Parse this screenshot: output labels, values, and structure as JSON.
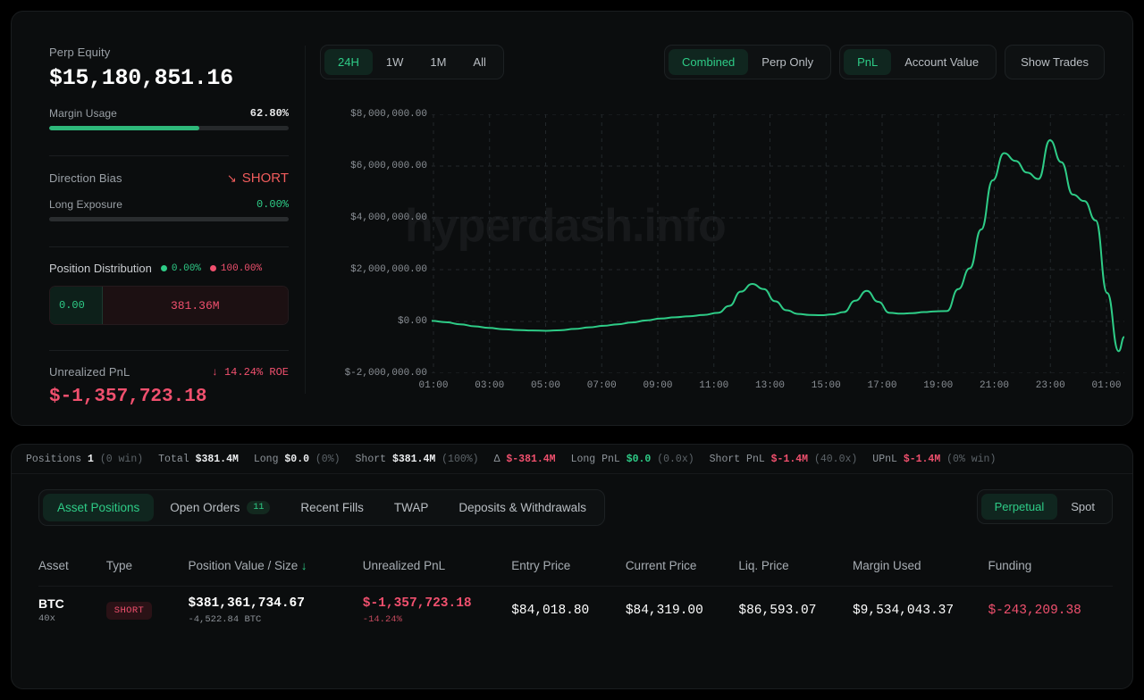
{
  "summary": {
    "equity_label": "Perp Equity",
    "equity_value": "$15,180,851.16",
    "margin_label": "Margin Usage",
    "margin_value": "62.80%",
    "margin_pct": 62.8,
    "direction_label": "Direction Bias",
    "direction_value": "SHORT",
    "direction_arrow": "↘",
    "long_exposure_label": "Long Exposure",
    "long_exposure_value": "0.00%",
    "long_exposure_pct": 0,
    "distribution_label": "Position Distribution",
    "distribution_long_pct": "0.00%",
    "distribution_short_pct": "100.00%",
    "distribution_long_value": "0.00",
    "distribution_short_value": "381.36M",
    "upnl_label": "Unrealized PnL",
    "upnl_roe": "↓ 14.24% ROE",
    "upnl_value": "$-1,357,723.18"
  },
  "chart_toolbar": {
    "ranges": [
      {
        "label": "24H",
        "active": true
      },
      {
        "label": "1W",
        "active": false
      },
      {
        "label": "1M",
        "active": false
      },
      {
        "label": "All",
        "active": false
      }
    ],
    "modes": [
      {
        "label": "Combined",
        "active": true
      },
      {
        "label": "Perp Only",
        "active": false
      }
    ],
    "metrics": [
      {
        "label": "PnL",
        "active": true
      },
      {
        "label": "Account Value",
        "active": false
      }
    ],
    "show_trades": "Show Trades"
  },
  "chart_data": {
    "type": "line",
    "title": "",
    "watermark": "hyperdash.info",
    "xlabel": "",
    "ylabel": "",
    "grid": true,
    "line_color": "#2ecc87",
    "ylim": [
      -2000000,
      8000000
    ],
    "ytick_labels": [
      "$8,000,000.00",
      "$6,000,000.00",
      "$4,000,000.00",
      "$2,000,000.00",
      "$0.00",
      "$-2,000,000.00"
    ],
    "yticks": [
      8000000,
      6000000,
      4000000,
      2000000,
      0,
      -2000000
    ],
    "xtick_labels": [
      "01:00",
      "03:00",
      "05:00",
      "07:00",
      "09:00",
      "11:00",
      "13:00",
      "15:00",
      "17:00",
      "19:00",
      "21:00",
      "23:00",
      "01:00"
    ],
    "x": [
      0.0,
      0.5,
      1.0,
      1.5,
      2.0,
      2.5,
      3.0,
      3.5,
      4.0,
      4.5,
      5.0,
      5.5,
      6.0,
      6.5,
      7.0,
      7.5,
      8.0,
      8.5,
      9.0,
      9.5,
      10.0,
      10.4,
      10.8,
      11.2,
      11.6,
      12.0,
      12.4,
      12.8,
      13.2,
      13.6,
      14.0,
      14.4,
      14.8,
      15.2,
      15.6,
      16.0,
      16.4,
      16.8,
      17.2,
      17.6,
      18.0,
      18.4,
      18.8,
      19.2,
      19.6,
      20.0,
      20.4,
      20.8,
      21.2,
      21.6,
      22.0,
      22.4,
      22.8,
      23.2,
      23.6,
      24.0,
      24.2
    ],
    "values": [
      20000,
      -30000,
      -110000,
      -190000,
      -250000,
      -300000,
      -330000,
      -350000,
      -360000,
      -340000,
      -290000,
      -230000,
      -170000,
      -110000,
      -40000,
      40000,
      110000,
      160000,
      200000,
      250000,
      330000,
      600000,
      1150000,
      1450000,
      1250000,
      780000,
      430000,
      290000,
      250000,
      240000,
      270000,
      360000,
      800000,
      1180000,
      760000,
      330000,
      300000,
      320000,
      360000,
      390000,
      400000,
      1250000,
      2050000,
      3550000,
      5450000,
      6500000,
      6200000,
      5750000,
      5500000,
      7000000,
      6150000,
      4900000,
      4650000,
      3900000,
      1100000,
      -1150000,
      -600000
    ],
    "series_name": "PnL"
  },
  "stats": [
    {
      "label": "Positions",
      "value": "1",
      "sub": "(0 win)",
      "tone": "white"
    },
    {
      "label": "Total",
      "value": "$381.4M",
      "sub": "",
      "tone": "white"
    },
    {
      "label": "Long",
      "value": "$0.0",
      "sub": "(0%)",
      "tone": "white"
    },
    {
      "label": "Short",
      "value": "$381.4M",
      "sub": "(100%)",
      "tone": "white"
    },
    {
      "label": "Δ",
      "value": "$-381.4M",
      "sub": "",
      "tone": "red"
    },
    {
      "label": "Long PnL",
      "value": "$0.0",
      "sub": "(0.0x)",
      "tone": "green"
    },
    {
      "label": "Short PnL",
      "value": "$-1.4M",
      "sub": "(40.0x)",
      "tone": "red"
    },
    {
      "label": "UPnL",
      "value": "$-1.4M",
      "sub": "(0% win)",
      "tone": "red"
    }
  ],
  "tabs": [
    {
      "label": "Asset Positions",
      "badge": "",
      "active": true
    },
    {
      "label": "Open Orders",
      "badge": "11",
      "active": false
    },
    {
      "label": "Recent Fills",
      "badge": "",
      "active": false
    },
    {
      "label": "TWAP",
      "badge": "",
      "active": false
    },
    {
      "label": "Deposits & Withdrawals",
      "badge": "",
      "active": false
    }
  ],
  "market_toggle": [
    {
      "label": "Perpetual",
      "active": true
    },
    {
      "label": "Spot",
      "active": false
    }
  ],
  "table": {
    "columns": [
      "Asset",
      "Type",
      "Position Value / Size",
      "Unrealized PnL",
      "Entry Price",
      "Current Price",
      "Liq. Price",
      "Margin Used",
      "Funding"
    ],
    "sort_indicator": "↓",
    "rows": [
      {
        "asset": "BTC",
        "leverage": "40x",
        "type": "SHORT",
        "position_value": "$381,361,734.67",
        "position_size": "-4,522.84 BTC",
        "unrealized_pnl": "$-1,357,723.18",
        "unrealized_pct": "-14.24%",
        "entry_price": "$84,018.80",
        "current_price": "$84,319.00",
        "liq_price": "$86,593.07",
        "margin_used": "$9,534,043.37",
        "funding": "$-243,209.38"
      }
    ]
  }
}
